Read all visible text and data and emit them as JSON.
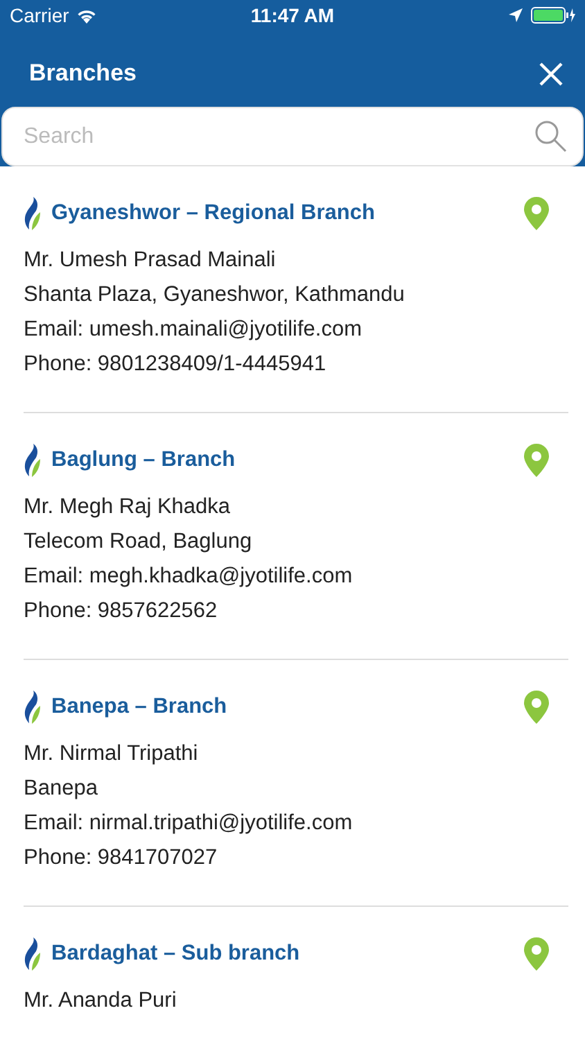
{
  "status_bar": {
    "carrier": "Carrier",
    "time": "11:47 AM"
  },
  "header": {
    "title": "Branches"
  },
  "search": {
    "placeholder": "Search"
  },
  "branches": [
    {
      "name": "Gyaneshwor – Regional Branch",
      "lines": [
        "Mr. Umesh Prasad Mainali",
        "Shanta Plaza, Gyaneshwor, Kathmandu",
        "Email: umesh.mainali@jyotilife.com",
        "Phone: 9801238409/1-4445941"
      ]
    },
    {
      "name": "Baglung – Branch",
      "lines": [
        "Mr. Megh Raj Khadka",
        "Telecom Road, Baglung",
        "Email: megh.khadka@jyotilife.com",
        "Phone: 9857622562"
      ]
    },
    {
      "name": "Banepa – Branch",
      "lines": [
        "Mr. Nirmal Tripathi",
        "Banepa",
        "Email: nirmal.tripathi@jyotilife.com",
        "Phone: 9841707027"
      ]
    },
    {
      "name": "Bardaghat – Sub branch",
      "lines": [
        "Mr. Ananda Puri"
      ]
    }
  ]
}
